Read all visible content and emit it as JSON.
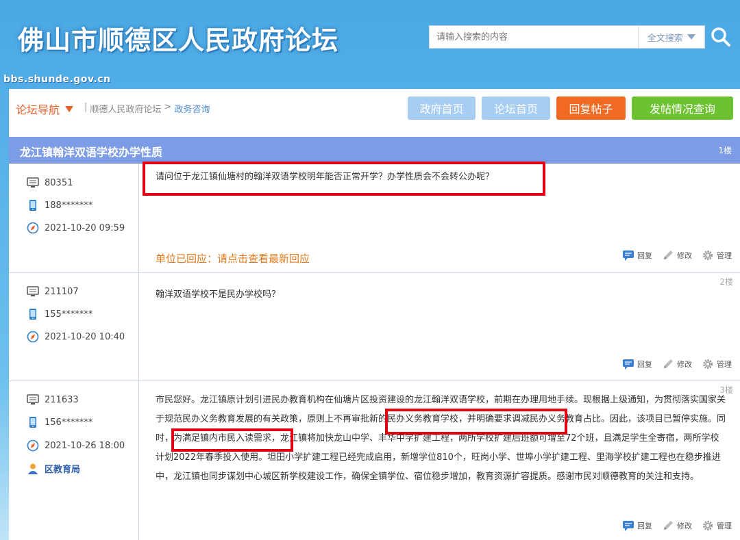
{
  "header": {
    "site_title": "佛山市顺德区人民政府论坛",
    "site_url": "bbs.shunde.gov.cn",
    "search_placeholder": "请输入搜索的内容",
    "search_type": "全文搜索"
  },
  "nav": {
    "label": "论坛导航",
    "breadcrumb": [
      "顺德人民政府论坛",
      "政务咨询"
    ],
    "buttons": {
      "gov_home": "政府首页",
      "forum_home": "论坛首页",
      "reply": "回复帖子",
      "query": "发帖情况查询"
    }
  },
  "thread": {
    "title": "龙江镇翰洋双语学校办学性质",
    "posts": [
      {
        "floor": "1楼",
        "id": "80351",
        "phone": "188*******",
        "time": "2021-10-20 09:59",
        "text": "请问位于龙江镇仙塘村的翰洋双语学校明年能否正常开学？办学性质会不会转公办呢？",
        "notice": "单位已回应：请点击查看最新回应"
      },
      {
        "floor": "2楼",
        "id": "211107",
        "phone": "155*******",
        "time": "2021-10-20 10:40",
        "text": "翰洋双语学校不是民办学校吗？"
      },
      {
        "floor": "3楼",
        "id": "211633",
        "phone": "156*******",
        "time": "2021-10-26 18:00",
        "org": "区教育局",
        "text": "市民您好。龙江镇原计划引进民办教育机构在仙塘片区投资建设的龙江翰洋双语学校，前期在办理用地手续。现根据上级通知，为贯彻落实国家关于规范民办义务教育发展的有关政策，原则上不再审批新的民办义务教育学校，并明确要求调减民办义务教育占比。因此，该项目已暂停实施。同时，为满足镇内市民入读需求，龙江镇将加快龙山中学、丰华中学扩建工程，两所学校扩建后班额可增至72个班，且满足学生全寄宿，两所学校计划2022年春季投入使用。坦田小学扩建工程已经完成启用，新增学位810个，旺岗小学、世埠小学扩建工程、里海学校扩建工程也在稳步推进中，龙江镇也同步谋划中心城区新学校建设工作，确保全镇学位、宿位稳步增加，教育资源扩容提质。感谢市民对顺德教育的关注和支持。"
      }
    ],
    "actions": {
      "reply": "回复",
      "edit": "修改",
      "manage": "管理"
    }
  },
  "colors": {
    "accent_orange": "#f06a22",
    "accent_green": "#6cc230",
    "thread_bar": "#7d9ce6",
    "highlight_red": "#e00012"
  }
}
